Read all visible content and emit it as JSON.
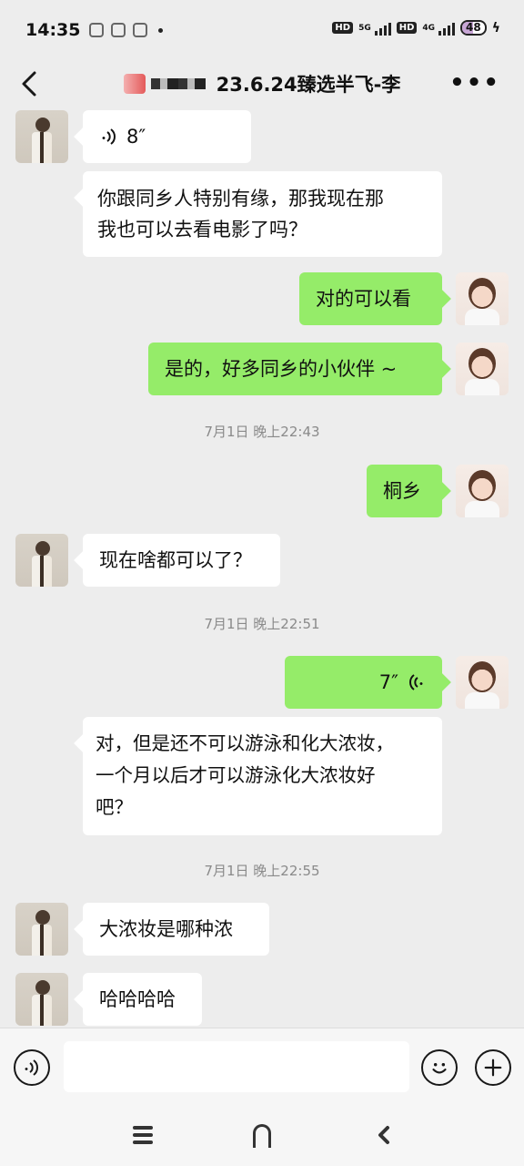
{
  "status_bar": {
    "time": "14:35",
    "net1": "5G",
    "net2": "4G",
    "battery": "48"
  },
  "header": {
    "title": "23.6.24臻选半飞-李"
  },
  "messages": [
    {
      "type": "voice",
      "side": "left",
      "duration": "8″"
    },
    {
      "type": "text",
      "side": "left",
      "text": "你跟同乡人特别有缘，那我现在那\n我也可以去看电影了吗？"
    },
    {
      "type": "text",
      "side": "right",
      "text": "对的可以看"
    },
    {
      "type": "text",
      "side": "right",
      "text": "是的，好多同乡的小伙伴 ~"
    },
    {
      "type": "time",
      "text": "7月1日 晚上22:43"
    },
    {
      "type": "text",
      "side": "right",
      "text": "桐乡"
    },
    {
      "type": "text",
      "side": "left",
      "text": "现在啥都可以了？"
    },
    {
      "type": "time",
      "text": "7月1日 晚上22:51"
    },
    {
      "type": "voice",
      "side": "right",
      "duration": "7″"
    },
    {
      "type": "text",
      "side": "left",
      "text": "对，但是还不可以游泳和化大浓妆，\n一个月以后才可以游泳化大浓妆好\n吧？"
    },
    {
      "type": "time",
      "text": "7月1日 晚上22:55"
    },
    {
      "type": "text",
      "side": "left",
      "text": "大浓妆是哪种浓"
    },
    {
      "type": "text",
      "side": "left",
      "text": "哈哈哈哈"
    }
  ],
  "colors": {
    "background": "#ededed",
    "bubble_self": "#95ec69",
    "bubble_other": "#ffffff"
  }
}
